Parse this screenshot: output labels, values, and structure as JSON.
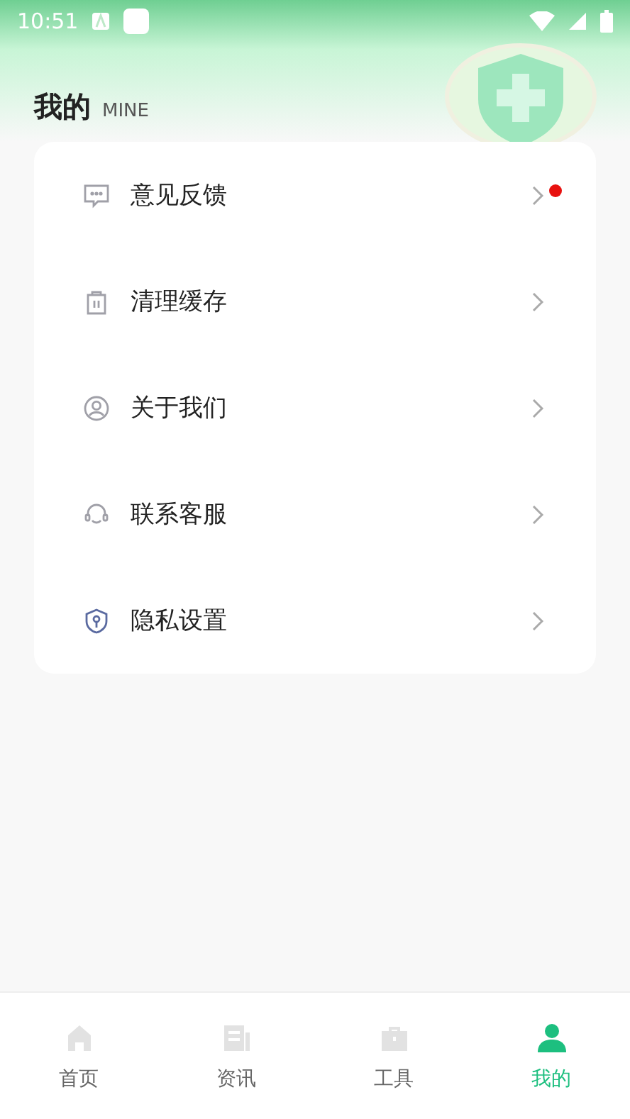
{
  "status_bar": {
    "time": "10:51"
  },
  "header": {
    "title": "我的",
    "subtitle": "MINE"
  },
  "menu": [
    {
      "kind": "feedback",
      "label": "意见反馈",
      "dot": true
    },
    {
      "kind": "trash",
      "label": "清理缓存",
      "dot": false
    },
    {
      "kind": "user",
      "label": "关于我们",
      "dot": false
    },
    {
      "kind": "headset",
      "label": "联系客服",
      "dot": false
    },
    {
      "kind": "shield",
      "label": "隐私设置",
      "dot": false
    }
  ],
  "tabs": [
    {
      "kind": "home",
      "label": "首页",
      "selected": false
    },
    {
      "kind": "news",
      "label": "资讯",
      "selected": false
    },
    {
      "kind": "tools",
      "label": "工具",
      "selected": false
    },
    {
      "kind": "person",
      "label": "我的",
      "selected": true
    }
  ]
}
